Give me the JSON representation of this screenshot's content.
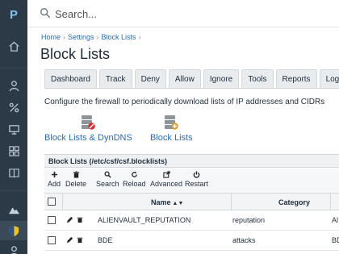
{
  "sidebar": {
    "logo": "P"
  },
  "search": {
    "placeholder": "Search..."
  },
  "breadcrumb": [
    "Home",
    "Settings",
    "Block Lists"
  ],
  "page_title": "Block Lists",
  "tabs": [
    "Dashboard",
    "Track",
    "Deny",
    "Allow",
    "Ignore",
    "Tools",
    "Reports",
    "Logs"
  ],
  "description": "Configure the firewall to periodically download lists of IP addresses and CIDRs",
  "links": {
    "blocklists_dyndns": "Block Lists & DynDNS",
    "blocklists": "Block Lists"
  },
  "panel": {
    "title": "Block Lists (/etc/csf/csf.blocklists)",
    "toolbar": [
      "Add",
      "Delete",
      "Search",
      "Reload",
      "Advanced",
      "Restart"
    ],
    "columns": {
      "name": "Name",
      "category": "Category"
    },
    "rows": [
      {
        "name": "ALIENVAULT_REPUTATION",
        "category": "reputation",
        "extra": "Al"
      },
      {
        "name": "BDE",
        "category": "attacks",
        "extra": "BDr"
      }
    ]
  },
  "colors": {
    "sidebar": "#2c3a47",
    "link": "#2a6bb8",
    "logo": "#7ec3f0"
  }
}
